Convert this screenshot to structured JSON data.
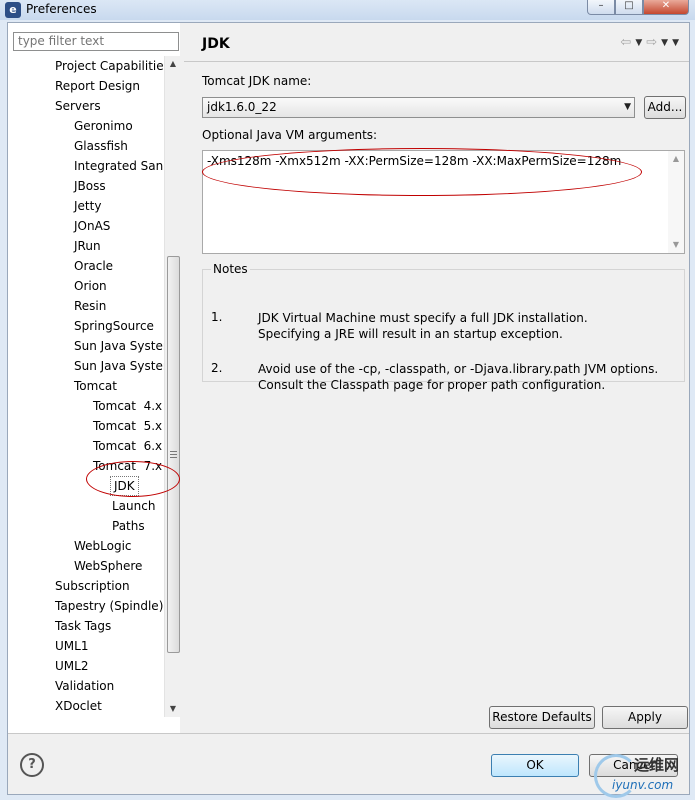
{
  "window": {
    "title": "Preferences",
    "icon": "eclipse-icon"
  },
  "filter": {
    "placeholder": "type filter text"
  },
  "tree": {
    "items": [
      {
        "label": "Project Capabilitie"
      },
      {
        "label": "Report Design"
      },
      {
        "label": "Servers"
      },
      {
        "label": "Geronimo"
      },
      {
        "label": "Glassfish"
      },
      {
        "label": "Integrated San"
      },
      {
        "label": "JBoss"
      },
      {
        "label": "Jetty"
      },
      {
        "label": "JOnAS"
      },
      {
        "label": "JRun"
      },
      {
        "label": "Oracle"
      },
      {
        "label": "Orion"
      },
      {
        "label": "Resin"
      },
      {
        "label": "SpringSource"
      },
      {
        "label": "Sun Java Syster"
      },
      {
        "label": "Sun Java Syster"
      },
      {
        "label": "Tomcat"
      },
      {
        "label": "Tomcat  4.x"
      },
      {
        "label": "Tomcat  5.x"
      },
      {
        "label": "Tomcat  6.x"
      },
      {
        "label": "Tomcat  7.x"
      },
      {
        "label": "JDK",
        "selected": true
      },
      {
        "label": "Launch"
      },
      {
        "label": "Paths"
      },
      {
        "label": "WebLogic"
      },
      {
        "label": "WebSphere"
      },
      {
        "label": "Subscription"
      },
      {
        "label": "Tapestry (Spindle)"
      },
      {
        "label": "Task Tags"
      },
      {
        "label": "UML1"
      },
      {
        "label": "UML2"
      },
      {
        "label": "Validation"
      },
      {
        "label": "XDoclet"
      }
    ]
  },
  "page": {
    "title": "JDK",
    "jdk_name_label": "Tomcat JDK name:",
    "jdk_selected": "jdk1.6.0_22",
    "add_label": "Add...",
    "vm_args_label": "Optional Java VM arguments:",
    "vm_args_value": "-Xms128m -Xmx512m -XX:PermSize=128m -XX:MaxPermSize=128m",
    "notes_title": "Notes",
    "notes": [
      {
        "num": "1.",
        "line1": "JDK Virtual Machine must specify a full JDK installation.",
        "line2": "Specifying a JRE will result in an startup exception."
      },
      {
        "num": "2.",
        "line1": "Avoid use of the -cp, -classpath, or -Djava.library.path JVM options.",
        "line2": "Consult the Classpath page for proper path configuration."
      }
    ],
    "restore_label": "Restore Defaults",
    "apply_label": "Apply"
  },
  "footer": {
    "ok_label": "OK",
    "cancel_label": "Cancel",
    "help_glyph": "?"
  },
  "watermark": {
    "main": "运维网",
    "sub": "iyunv.com"
  },
  "colors": {
    "annotation": "#c00000",
    "selection": "#ffffff"
  }
}
